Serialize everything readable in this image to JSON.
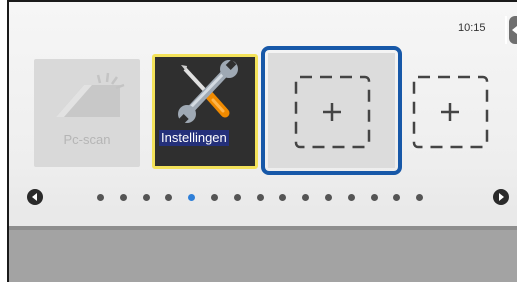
{
  "status": {
    "time": "10:15"
  },
  "tiles": {
    "pcscan": {
      "label": "Pc-scan",
      "icon": "scan-to-pc-icon",
      "enabled": false
    },
    "settings": {
      "label": "Instellingen",
      "icon": "wrench-screwdriver-icon"
    },
    "empty1": {
      "label": "+",
      "icon": "add-shortcut-icon"
    },
    "empty2": {
      "label": "+",
      "icon": "add-shortcut-icon"
    }
  },
  "pagination": {
    "total": 15,
    "current": 5
  },
  "colors": {
    "selection": "#1758a8",
    "active_dot": "#2f7fd8",
    "settings_border": "#f3e25a"
  }
}
